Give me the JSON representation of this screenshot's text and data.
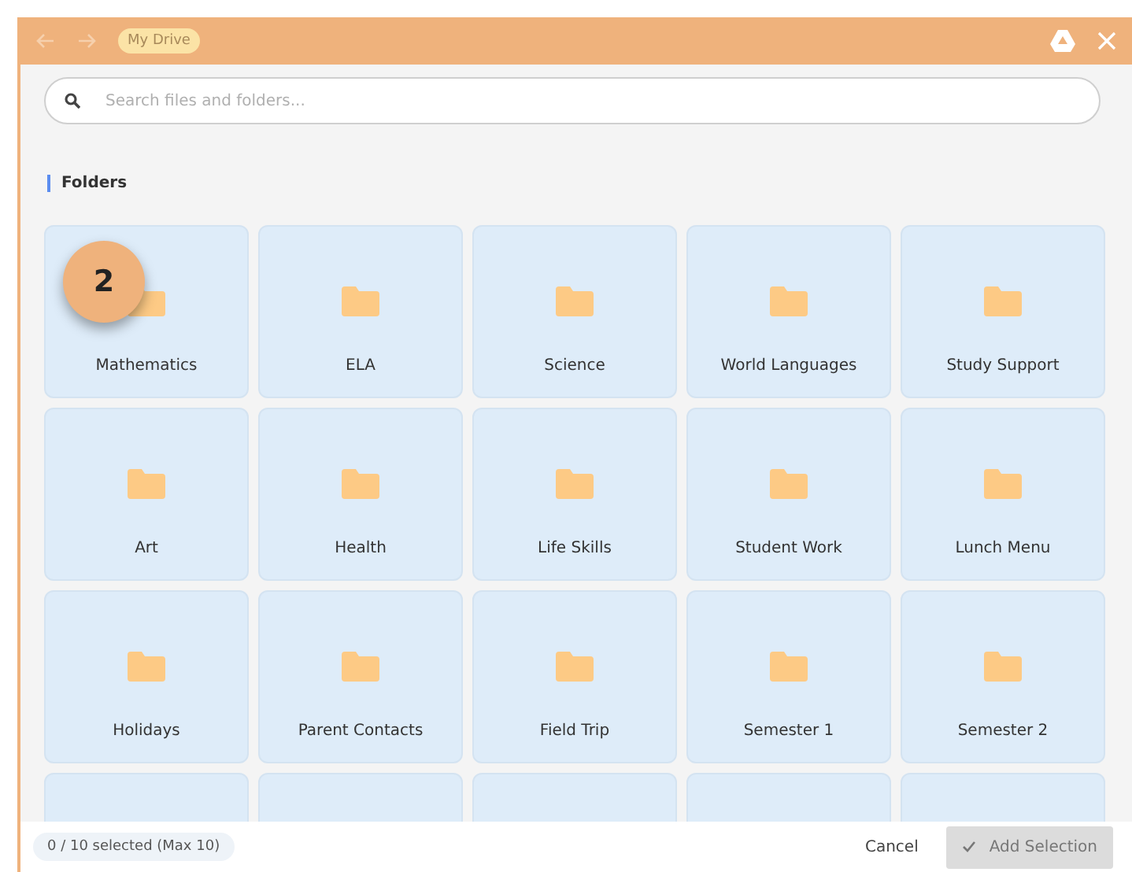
{
  "header": {
    "breadcrumb": "My Drive"
  },
  "search": {
    "placeholder": "Search files and folders..."
  },
  "section": {
    "title": "Folders"
  },
  "step_badge": "2",
  "folders": [
    {
      "name": "Mathematics"
    },
    {
      "name": "ELA"
    },
    {
      "name": "Science"
    },
    {
      "name": "World Languages"
    },
    {
      "name": "Study Support"
    },
    {
      "name": "Art"
    },
    {
      "name": "Health"
    },
    {
      "name": "Life Skills"
    },
    {
      "name": "Student Work"
    },
    {
      "name": "Lunch Menu"
    },
    {
      "name": "Holidays"
    },
    {
      "name": "Parent Contacts"
    },
    {
      "name": "Field Trip"
    },
    {
      "name": "Semester 1"
    },
    {
      "name": "Semester 2"
    }
  ],
  "footer": {
    "selection_count": "0 / 10 selected (Max 10)",
    "cancel": "Cancel",
    "add": "Add Selection",
    "add_disabled": true
  }
}
